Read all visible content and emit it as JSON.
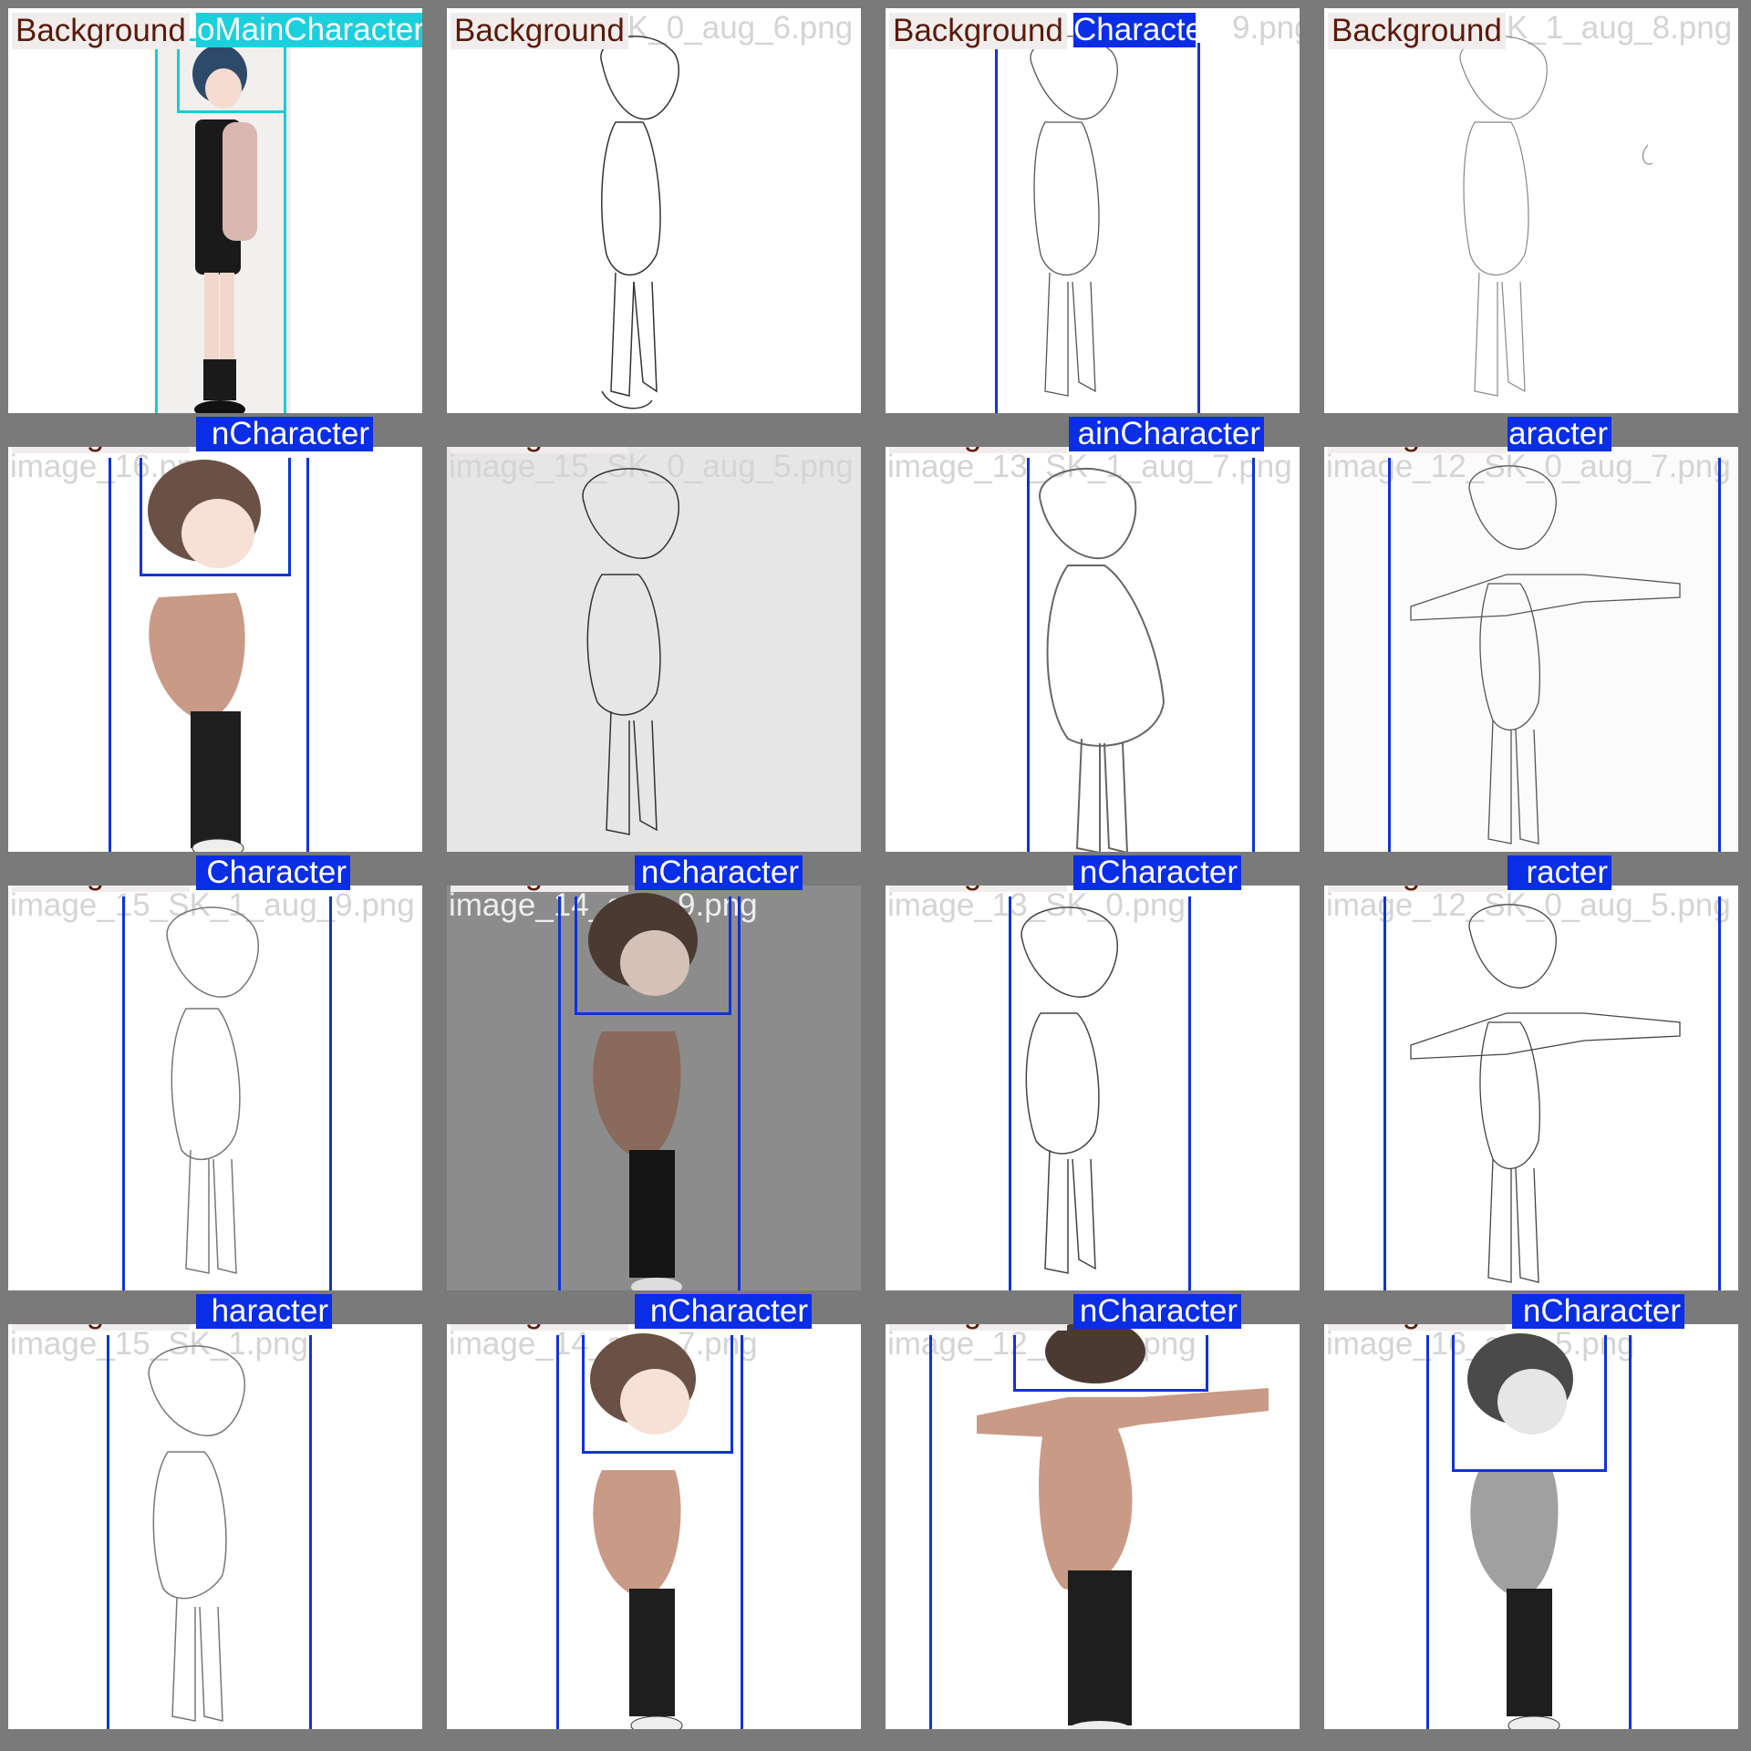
{
  "grid_title": "",
  "colors": {
    "grid_gray": "#7a7a7a",
    "box_blue": "#1034d4",
    "box_cyan": "#1bcbd8",
    "label_brown": "#5a1a0a"
  },
  "tiles": [
    {
      "bg": "Background",
      "cls": "oMainCharacter",
      "cls_color": "cyan",
      "file": "",
      "fill": "white",
      "style": "color-girl"
    },
    {
      "bg": "Background",
      "cls": "",
      "cls_color": "",
      "file": "K_0_aug_6.png",
      "fill": "white",
      "style": "lineart"
    },
    {
      "bg": "Background",
      "cls": "Character",
      "cls_color": "blue",
      "file": "9.png",
      "fill": "white",
      "style": "lineart"
    },
    {
      "bg": "Background",
      "cls": "",
      "cls_color": "",
      "file": "K_1_aug_8.png",
      "fill": "white",
      "style": "lineart"
    },
    {
      "bg": "Background",
      "cls": "nCharacter",
      "cls_color": "blue",
      "file": "image_16.png",
      "fill": "white",
      "style": "color-boy"
    },
    {
      "bg": "Background",
      "cls": "",
      "cls_color": "",
      "file": "image_15_SK_0_aug_5.png",
      "fill": "lightgray",
      "style": "lineart"
    },
    {
      "bg": "Background",
      "cls": "ainCharacter",
      "cls_color": "blue",
      "file": "image_13_SK_1_aug_7.png",
      "fill": "white",
      "style": "lineart"
    },
    {
      "bg": "Background",
      "cls": "aracter",
      "cls_color": "blue",
      "file": "image_12_SK_0_aug_7.png",
      "fill": "offwhite",
      "style": "tpose-line"
    },
    {
      "bg": "Background",
      "cls": "Character",
      "cls_color": "blue",
      "file": "image_15_SK_1_aug_9.png",
      "fill": "white",
      "style": "lineart"
    },
    {
      "bg": "Background",
      "cls": "nCharacter",
      "cls_color": "blue",
      "file": "image_14_aug_9.png",
      "fill": "midgray",
      "style": "color-boy-dark"
    },
    {
      "bg": "Background",
      "cls": "nCharacter",
      "cls_color": "blue",
      "file": "image_13_SK_0.png",
      "fill": "white",
      "style": "lineart"
    },
    {
      "bg": "Background",
      "cls": "racter",
      "cls_color": "blue",
      "file": "image_12_SK_0_aug_5.png",
      "fill": "white",
      "style": "tpose-line"
    },
    {
      "bg": "Background",
      "cls": "haracter",
      "cls_color": "blue",
      "file": "image_15_SK_1.png",
      "fill": "white",
      "style": "lineart"
    },
    {
      "bg": "Background",
      "cls": "nCharacter",
      "cls_color": "blue",
      "file": "image_14_aug_7.png",
      "fill": "white",
      "style": "color-boy"
    },
    {
      "bg": "Background",
      "cls": "nCharacter",
      "cls_color": "blue",
      "file": "image_12_aug_8.png",
      "fill": "white",
      "style": "tpose-color"
    },
    {
      "bg": "Background",
      "cls": "nCharacter",
      "cls_color": "blue",
      "file": "image_16_aug_5.png",
      "fill": "white",
      "style": "gray-boy"
    }
  ]
}
